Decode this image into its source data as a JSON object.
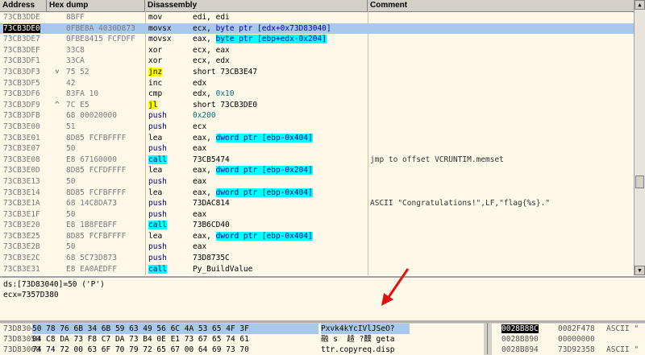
{
  "columns": {
    "address": "Address",
    "hex_dump": "Hex dump",
    "disassembly": "Disassembly",
    "comment": "Comment"
  },
  "disasm_rows": [
    {
      "addr": "73CB3DDE",
      "mark": "",
      "hex": "8BFF",
      "mn": "mov",
      "op": "edi, edi",
      "cm": "",
      "style": ""
    },
    {
      "addr": "73CB3DE0",
      "mark": "",
      "hex": "0FBE8A 4030D873",
      "mn": "movsx",
      "op": "ecx, byte ptr [edx+0x73D83040]",
      "cm": "",
      "style": "sel cur"
    },
    {
      "addr": "73CB3DE7",
      "mark": "",
      "hex": "0FBE8415 FCFDFF",
      "mn": "movsx",
      "op": "eax, byte ptr [ebp+edx-0x204]",
      "cm": "",
      "style": "memop"
    },
    {
      "addr": "73CB3DEF",
      "mark": "",
      "hex": "33C8",
      "mn": "xor",
      "op": "ecx, eax",
      "cm": "",
      "style": ""
    },
    {
      "addr": "73CB3DF1",
      "mark": "",
      "hex": "33CA",
      "mn": "xor",
      "op": "ecx, edx",
      "cm": "",
      "style": ""
    },
    {
      "addr": "73CB3DF3",
      "mark": "˅",
      "hex": "75 52",
      "mn": "jnz",
      "op": "short 73CB3E47",
      "cm": "",
      "style": "jmp"
    },
    {
      "addr": "73CB3DF5",
      "mark": "",
      "hex": "42",
      "mn": "inc",
      "op": "edx",
      "cm": "",
      "style": ""
    },
    {
      "addr": "73CB3DF6",
      "mark": "",
      "hex": "83FA 10",
      "mn": "cmp",
      "op": "edx, 0x10",
      "cm": "",
      "style": "imm"
    },
    {
      "addr": "73CB3DF9",
      "mark": "^",
      "hex": "7C E5",
      "mn": "jl",
      "op": "short 73CB3DE0",
      "cm": "",
      "style": "jmp"
    },
    {
      "addr": "73CB3DFB",
      "mark": "",
      "hex": "68 00020000",
      "mn": "push",
      "op": "0x200",
      "cm": "",
      "style": "push imm"
    },
    {
      "addr": "73CB3E00",
      "mark": "",
      "hex": "51",
      "mn": "push",
      "op": "ecx",
      "cm": "",
      "style": "push"
    },
    {
      "addr": "73CB3E01",
      "mark": "",
      "hex": "8D85 FCFBFFFF",
      "mn": "lea",
      "op": "eax, dword ptr [ebp-0x404]",
      "cm": "",
      "style": "memop"
    },
    {
      "addr": "73CB3E07",
      "mark": "",
      "hex": "50",
      "mn": "push",
      "op": "eax",
      "cm": "",
      "style": "push"
    },
    {
      "addr": "73CB3E08",
      "mark": "",
      "hex": "E8 67160000",
      "mn": "call",
      "op": "73CB5474",
      "cm": "jmp to offset VCRUNTIM.memset",
      "style": "call"
    },
    {
      "addr": "73CB3E0D",
      "mark": "",
      "hex": "8D85 FCFDFFFF",
      "mn": "lea",
      "op": "eax, dword ptr [ebp-0x204]",
      "cm": "",
      "style": "memop"
    },
    {
      "addr": "73CB3E13",
      "mark": "",
      "hex": "50",
      "mn": "push",
      "op": "eax",
      "cm": "",
      "style": "push"
    },
    {
      "addr": "73CB3E14",
      "mark": "",
      "hex": "8D85 FCFBFFFF",
      "mn": "lea",
      "op": "eax, dword ptr [ebp-0x404]",
      "cm": "",
      "style": "memop"
    },
    {
      "addr": "73CB3E1A",
      "mark": "",
      "hex": "68 14C8DA73",
      "mn": "push",
      "op": "73DAC814",
      "cm": "ASCII \"Congratulations!\",LF,\"flag{%s}.\"",
      "style": "push"
    },
    {
      "addr": "73CB3E1F",
      "mark": "",
      "hex": "50",
      "mn": "push",
      "op": "eax",
      "cm": "",
      "style": "push"
    },
    {
      "addr": "73CB3E20",
      "mark": "",
      "hex": "E8 1B8FEBFF",
      "mn": "call",
      "op": "73B6CD40",
      "cm": "",
      "style": "call"
    },
    {
      "addr": "73CB3E25",
      "mark": "",
      "hex": "8D85 FCFBFFFF",
      "mn": "lea",
      "op": "eax, dword ptr [ebp-0x404]",
      "cm": "",
      "style": "memop"
    },
    {
      "addr": "73CB3E2B",
      "mark": "",
      "hex": "50",
      "mn": "push",
      "op": "eax",
      "cm": "",
      "style": "push"
    },
    {
      "addr": "73CB3E2C",
      "mark": "",
      "hex": "68 5C73D873",
      "mn": "push",
      "op": "73D8735C",
      "cm": "",
      "style": "push"
    },
    {
      "addr": "73CB3E31",
      "mark": "",
      "hex": "E8 EA0AEDFF",
      "mn": "call",
      "op": "Py_BuildValue",
      "cm": "",
      "style": "call"
    }
  ],
  "info": {
    "line1": "ds:[73D83040]=50 ('P')",
    "line2": "ecx=7357D380"
  },
  "dump_rows": [
    {
      "addr": "73D83040",
      "hex": "50 78 76 6B 34 6B 59 63 49 56 6C 4A 53 65 4F 3F",
      "text": "Pxvk4kYcIVlJSeO?",
      "sel": true
    },
    {
      "addr": "73D83050",
      "hex": "04 C8 DA 73 F8 C7 DA 73 B4 0E E1 73 67 65 74 61",
      "text": "融 s  趏 ?醭 geta",
      "sel": false
    },
    {
      "addr": "73D83060",
      "hex": "74 74 72 00 63 6F 70 79 72 65 67 00 64 69 73 70",
      "text": "ttr.copyreq.disp",
      "sel": false
    }
  ],
  "stack_rows": [
    {
      "addr": "0028B88C",
      "val": "0082F478",
      "cm": "ASCII \"",
      "top": true
    },
    {
      "addr": "0028B890",
      "val": "00000000",
      "cm": "",
      "top": false
    },
    {
      "addr": "0028B894",
      "val": "73D92358",
      "cm": "ASCII \"",
      "top": false
    }
  ],
  "colors": {
    "selection": "#a8c8ec",
    "operand_highlight": "#00ffff",
    "jump_highlight": "#ffff00",
    "pane_background": "#fdf8e8"
  }
}
